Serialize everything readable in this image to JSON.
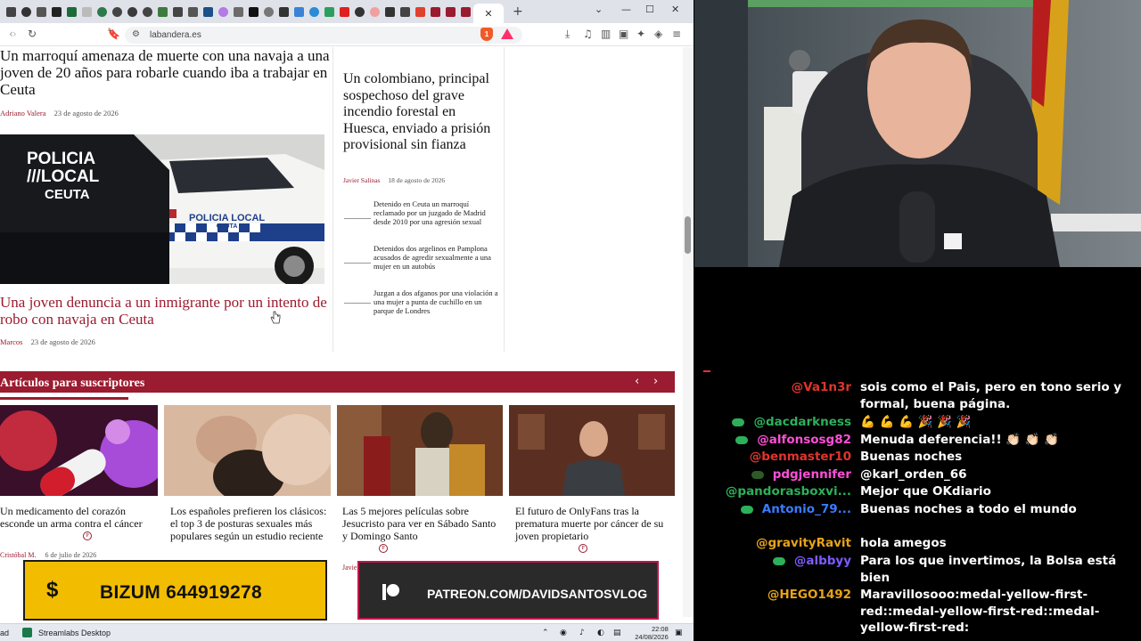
{
  "browser": {
    "url": "labandera.es",
    "shield_count": "1",
    "nav_icons": [
      "back-arrow-icon",
      "forward-arrow-icon",
      "reload-icon",
      "bookmark-icon"
    ],
    "toolbar_icons": [
      "download-icon",
      "media-icon",
      "reader-icon",
      "wallet-icon",
      "ai-icon",
      "vpn-icon",
      "menu-icon"
    ]
  },
  "article": {
    "top_title": "Un marroquí amenaza de muerte con una navaja a una joven de 20 años para robarle cuando iba a trabajar en Ceuta",
    "top_author": "Adriano Valera",
    "top_date": "23 de agosto de 2026",
    "photo_text": {
      "vest_line1": "POLICIA",
      "vest_line2": "///LOCAL",
      "vest_line3": "CEUTA",
      "car_line1": "POLICIA LOCAL",
      "car_line2": "CEUTA"
    },
    "main_title": "Una joven denuncia a un inmigrante por un intento de robo con navaja en Ceuta",
    "main_author": "Marcos",
    "main_date": "23 de agosto de 2026"
  },
  "sidebar": {
    "title": "Un colombiano, principal sospechoso del grave incendio forestal en Huesca, enviado a prisión provisional sin fianza",
    "author": "Javier Salinas",
    "date": "18 de agosto de 2026",
    "related": [
      "Detenido en Ceuta un marroquí reclamado por un juzgado de Madrid desde 2010 por una agresión sexual",
      "Detenidos dos argelinos en Pamplona acusados de agredir sexualmente a una mujer en un autobús",
      "Juzgan a dos afganos por una violación a una mujer a punta de cuchillo en un parque de Londres"
    ]
  },
  "subscribers": {
    "title": "Artículos para suscriptores",
    "cards": [
      {
        "title": "Un medicamento del corazón esconde un arma contra el cáncer",
        "author": "Cristóbal M.",
        "date": "6 de julio de 2026"
      },
      {
        "title": "Los españoles prefieren los clásicos: el top 3 de posturas sexuales más populares según un estudio reciente",
        "author": "",
        "date": ""
      },
      {
        "title": "Las 5 mejores películas sobre Jesucristo para ver en Sábado Santo y Domingo Santo",
        "author": "Javier",
        "date": ""
      },
      {
        "title": "El futuro de OnlyFans tras la prematura muerte por cáncer de su joven propietario",
        "author": "",
        "date": ""
      }
    ]
  },
  "overlays": {
    "bizum_symbol": "$",
    "bizum_text": "BIZUM 644919278",
    "patreon_text": "PATREON.COM/DAVIDSANTOSVLOG"
  },
  "taskbar": {
    "left_text": "ad",
    "app_label": "Streamlabs Desktop",
    "time": "22:08",
    "date": "24/08/2026"
  },
  "chat": {
    "messages": [
      {
        "user": "@Va1n3r",
        "color": "#e0342e",
        "text": "sois como el Pais, pero en tono serio y formal, buena página.",
        "badge": ""
      },
      {
        "user": "@dacdarkness",
        "color": "#2cb05a",
        "text": "💪 💪 💪 🎉 🎉 🎉",
        "badge": "#2cb05a"
      },
      {
        "user": "@alfonsosg82",
        "color": "#ff4fd8",
        "text": "Menuda deferencia!! 👏🏻 👏🏻 👏🏻",
        "badge": "#2cb05a"
      },
      {
        "user": "@benmaster10",
        "color": "#e0342e",
        "text": "Buenas noches",
        "badge": ""
      },
      {
        "user": "pdgjennifer",
        "color": "#ff4fd8",
        "text": "@karl_orden_66",
        "badge": "#2d5a27"
      },
      {
        "user": "@pandorasboxvi...",
        "color": "#2cb05a",
        "text": "Mejor que OKdiario",
        "badge": ""
      },
      {
        "user": "Antonio_79...",
        "color": "#3a7bff",
        "text": "Buenas noches a todo el mundo",
        "badge": "#2cb05a"
      },
      {
        "user": "@gravityRavit",
        "color": "#e8a317",
        "text": "hola amegos",
        "badge": ""
      },
      {
        "user": "@albbyy",
        "color": "#7b5cff",
        "text": "Para los que invertimos, la Bolsa está bien",
        "badge": "#2cb05a"
      },
      {
        "user": "@HEGO1492",
        "color": "#e8a317",
        "text": "Maravillosooo:medal-yellow-first-red::medal-yellow-first-red::medal-yellow-first-red:",
        "badge": ""
      }
    ]
  }
}
